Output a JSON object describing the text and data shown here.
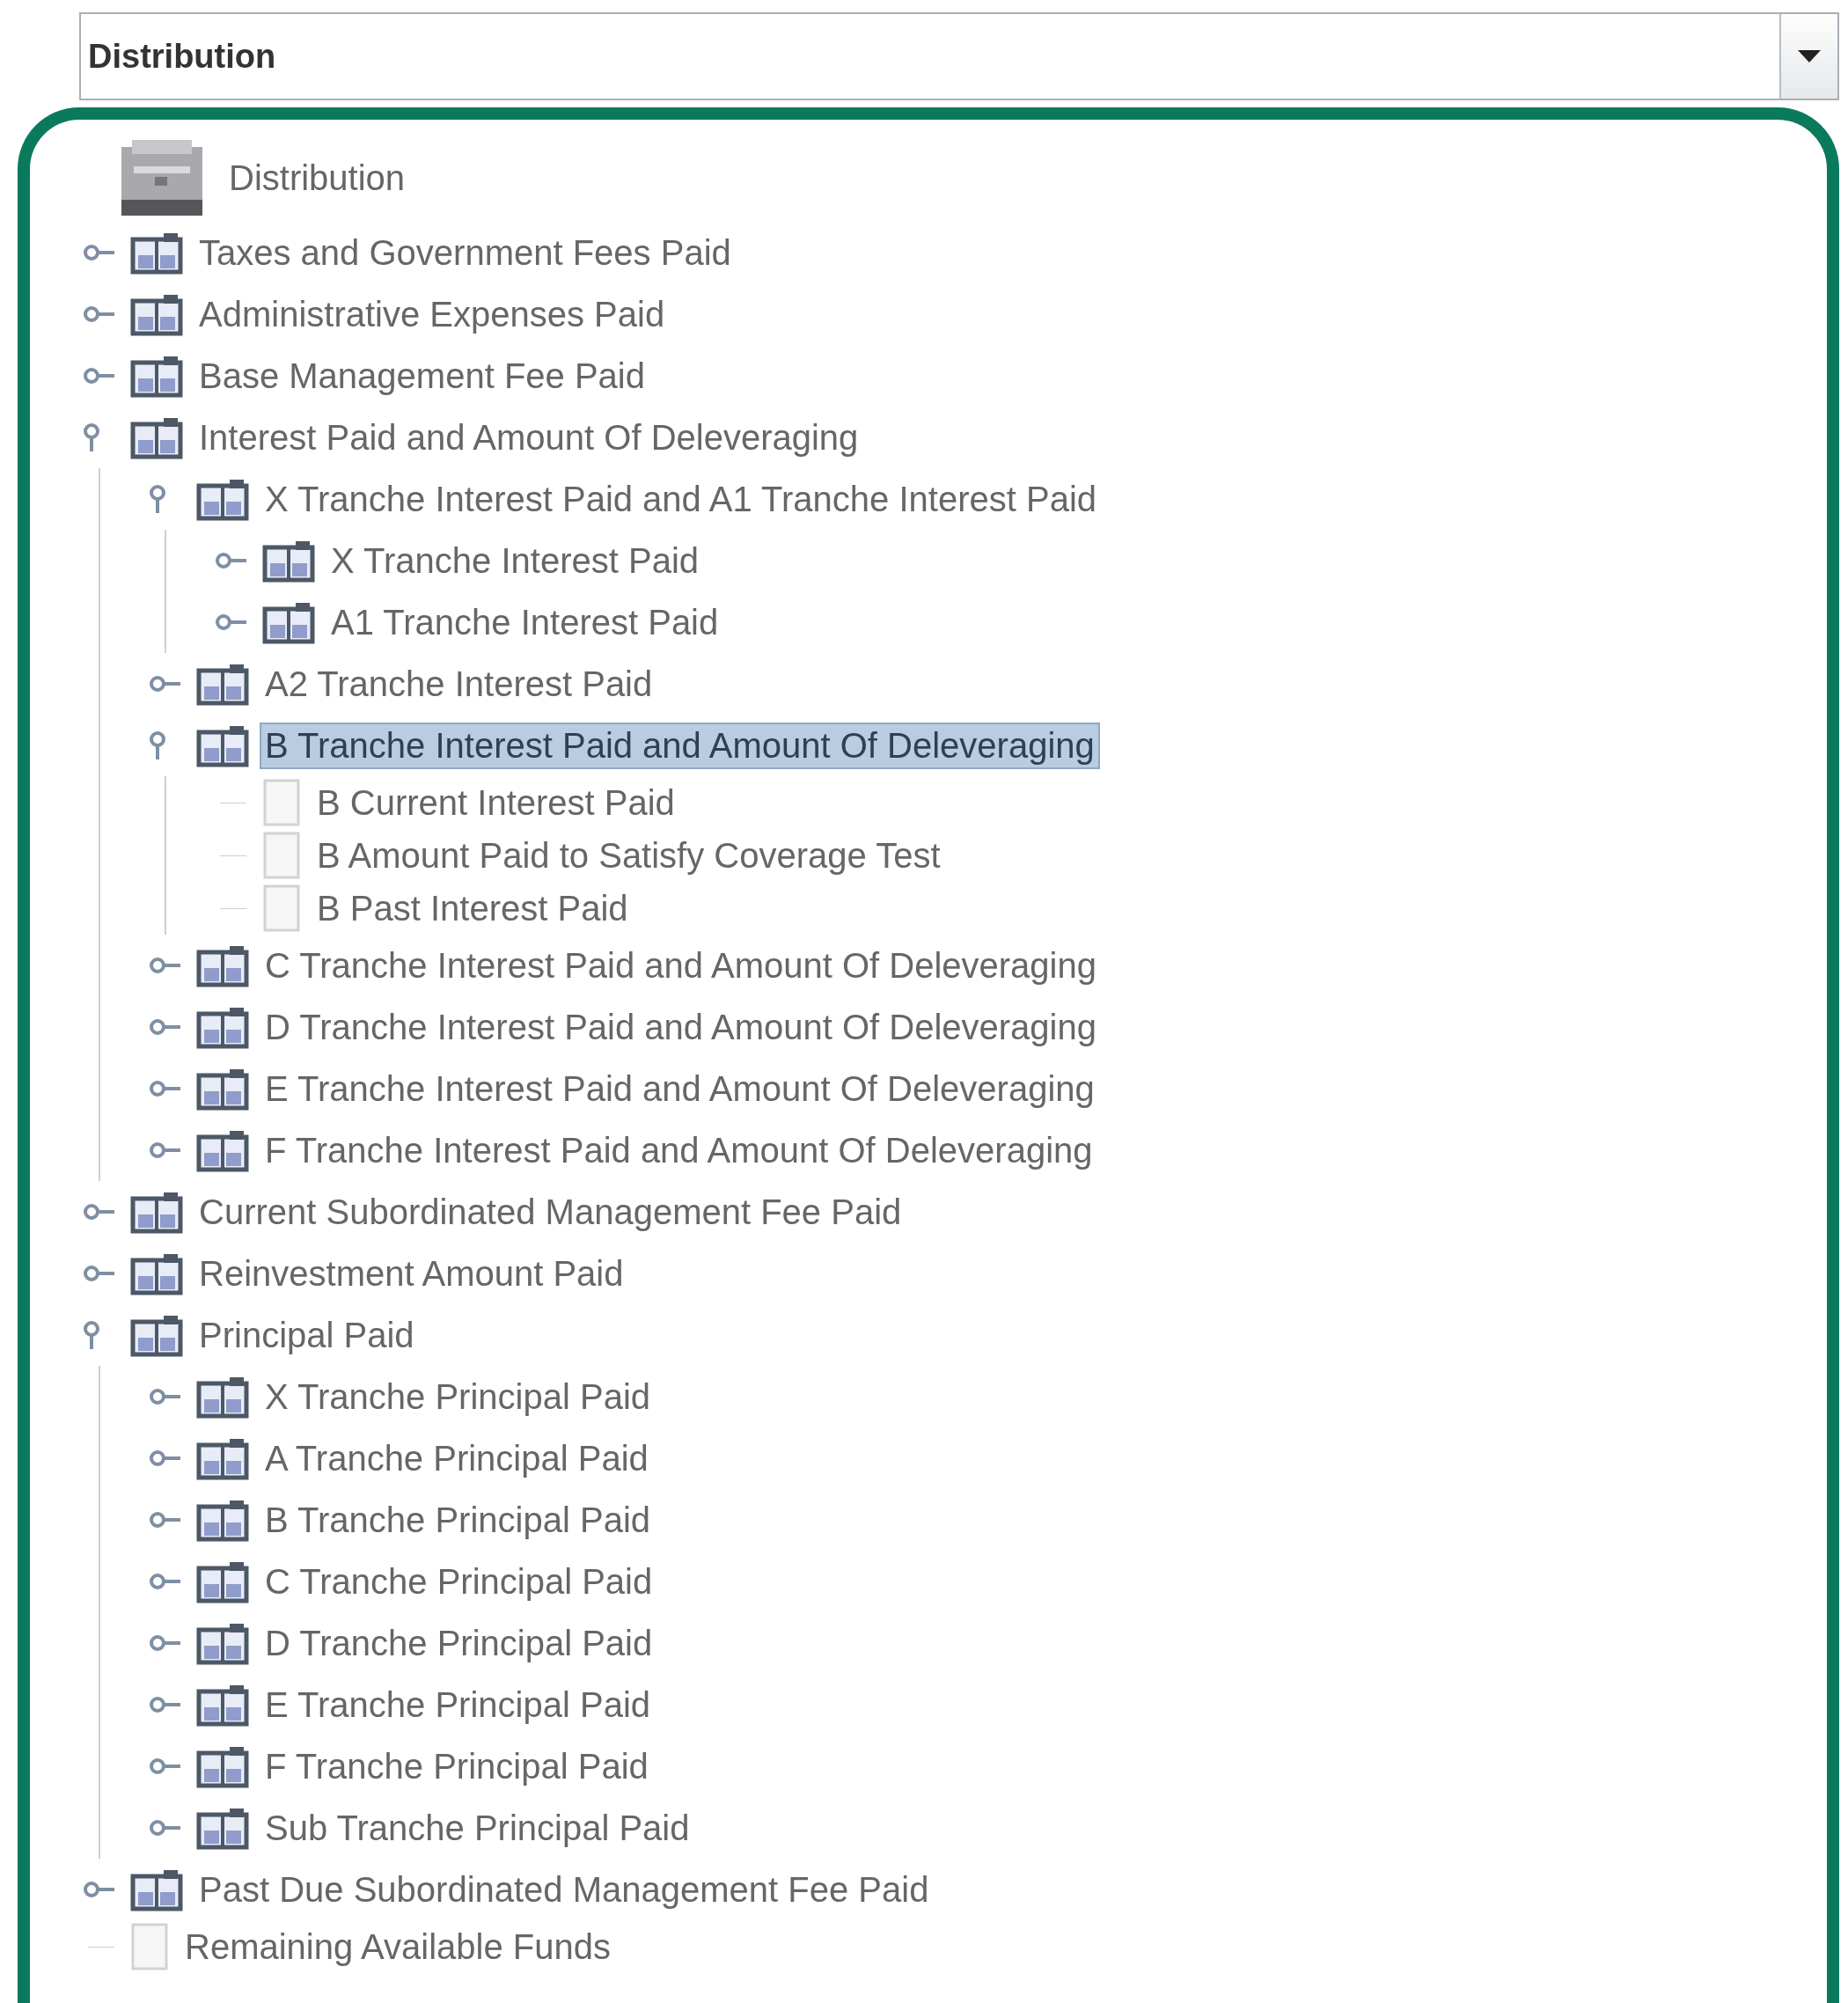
{
  "selector": {
    "value": "Distribution"
  },
  "tree": {
    "label": "Distribution",
    "selected": false,
    "children": [
      {
        "kind": "branch",
        "label": "Taxes and Government Fees Paid",
        "expanded": false,
        "selected": false
      },
      {
        "kind": "branch",
        "label": "Administrative Expenses Paid",
        "expanded": false,
        "selected": false
      },
      {
        "kind": "branch",
        "label": "Base Management Fee Paid",
        "expanded": false,
        "selected": false
      },
      {
        "kind": "branch",
        "label": "Interest Paid and Amount Of Deleveraging",
        "expanded": true,
        "selected": false,
        "children": [
          {
            "kind": "branch",
            "label": "X Tranche Interest Paid and A1 Tranche Interest Paid",
            "expanded": true,
            "selected": false,
            "children": [
              {
                "kind": "branch",
                "label": "X Tranche Interest Paid",
                "expanded": false,
                "selected": false
              },
              {
                "kind": "branch",
                "label": "A1 Tranche Interest Paid",
                "expanded": false,
                "selected": false
              }
            ]
          },
          {
            "kind": "branch",
            "label": "A2 Tranche Interest Paid",
            "expanded": false,
            "selected": false
          },
          {
            "kind": "branch",
            "label": "B Tranche Interest Paid and Amount Of Deleveraging",
            "expanded": true,
            "selected": true,
            "children": [
              {
                "kind": "leaf",
                "label": "B Current Interest Paid",
                "selected": false
              },
              {
                "kind": "leaf",
                "label": "B Amount Paid to Satisfy Coverage Test",
                "selected": false
              },
              {
                "kind": "leaf",
                "label": "B Past Interest Paid",
                "selected": false
              }
            ]
          },
          {
            "kind": "branch",
            "label": "C Tranche Interest Paid and Amount Of Deleveraging",
            "expanded": false,
            "selected": false
          },
          {
            "kind": "branch",
            "label": "D Tranche Interest Paid and Amount Of Deleveraging",
            "expanded": false,
            "selected": false
          },
          {
            "kind": "branch",
            "label": "E Tranche Interest Paid and Amount Of Deleveraging",
            "expanded": false,
            "selected": false
          },
          {
            "kind": "branch",
            "label": "F Tranche Interest Paid and Amount Of Deleveraging",
            "expanded": false,
            "selected": false
          }
        ]
      },
      {
        "kind": "branch",
        "label": "Current Subordinated Management Fee Paid",
        "expanded": false,
        "selected": false
      },
      {
        "kind": "branch",
        "label": "Reinvestment Amount Paid",
        "expanded": false,
        "selected": false
      },
      {
        "kind": "branch",
        "label": "Principal Paid",
        "expanded": true,
        "selected": false,
        "children": [
          {
            "kind": "branch",
            "label": "X Tranche Principal Paid",
            "expanded": false,
            "selected": false
          },
          {
            "kind": "branch",
            "label": "A Tranche Principal Paid",
            "expanded": false,
            "selected": false
          },
          {
            "kind": "branch",
            "label": "B Tranche Principal Paid",
            "expanded": false,
            "selected": false
          },
          {
            "kind": "branch",
            "label": "C Tranche Principal Paid",
            "expanded": false,
            "selected": false
          },
          {
            "kind": "branch",
            "label": "D Tranche Principal Paid",
            "expanded": false,
            "selected": false
          },
          {
            "kind": "branch",
            "label": "E Tranche Principal Paid",
            "expanded": false,
            "selected": false
          },
          {
            "kind": "branch",
            "label": "F Tranche Principal Paid",
            "expanded": false,
            "selected": false
          },
          {
            "kind": "branch",
            "label": "Sub Tranche Principal Paid",
            "expanded": false,
            "selected": false
          }
        ]
      },
      {
        "kind": "branch",
        "label": "Past Due Subordinated Management Fee Paid",
        "expanded": false,
        "selected": false
      },
      {
        "kind": "leaf",
        "label": "Remaining Available Funds",
        "selected": false
      }
    ]
  }
}
